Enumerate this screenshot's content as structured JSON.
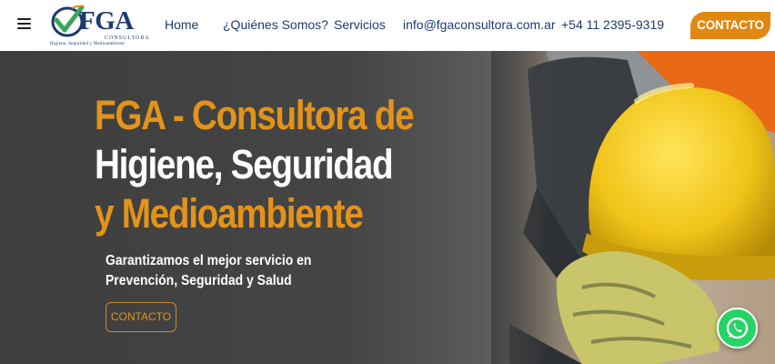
{
  "header": {
    "logo": {
      "name": "FGA",
      "tagline": "CONSULTORA",
      "subtitle": "Higiene, Seguridad y Medioambiente"
    },
    "nav": [
      {
        "label": "Home"
      },
      {
        "label": "¿Quiénes Somos?"
      },
      {
        "label": "Servicios"
      },
      {
        "label": "info@fgaconsultora.com.ar"
      },
      {
        "label": "+54 11 2395-9319"
      }
    ],
    "cta_label": "CONTACTO"
  },
  "hero": {
    "title_line1": "FGA - Consultora de",
    "title_line2": "Higiene, Seguridad",
    "title_line3": "y Medioambiente",
    "subtitle": "Garantizamos el mejor servicio en Prevención, Seguridad y Salud",
    "button_label": "CONTACTO"
  },
  "colors": {
    "brand_navy": "#1d3b6e",
    "accent_orange": "#e0880f",
    "whatsapp_green": "#25d366"
  },
  "icons": [
    "menu-icon",
    "check-logo-icon",
    "whatsapp-icon"
  ]
}
